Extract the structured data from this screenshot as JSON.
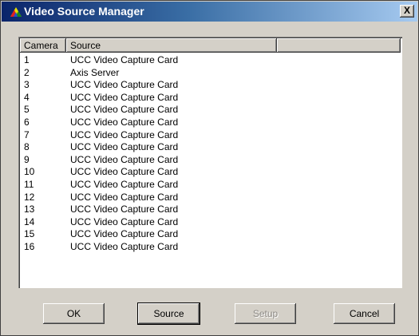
{
  "window": {
    "title": "Video Source Manager",
    "close_label": "X"
  },
  "list": {
    "columns": [
      "Camera",
      "Source",
      ""
    ],
    "rows": [
      {
        "camera": "1",
        "source": "UCC Video Capture Card"
      },
      {
        "camera": "2",
        "source": "Axis Server"
      },
      {
        "camera": "3",
        "source": "UCC Video Capture Card"
      },
      {
        "camera": "4",
        "source": "UCC Video Capture Card"
      },
      {
        "camera": "5",
        "source": "UCC Video Capture Card"
      },
      {
        "camera": "6",
        "source": "UCC Video Capture Card"
      },
      {
        "camera": "7",
        "source": "UCC Video Capture Card"
      },
      {
        "camera": "8",
        "source": "UCC Video Capture Card"
      },
      {
        "camera": "9",
        "source": "UCC Video Capture Card"
      },
      {
        "camera": "10",
        "source": "UCC Video Capture Card"
      },
      {
        "camera": "11",
        "source": "UCC Video Capture Card"
      },
      {
        "camera": "12",
        "source": "UCC Video Capture Card"
      },
      {
        "camera": "13",
        "source": "UCC Video Capture Card"
      },
      {
        "camera": "14",
        "source": "UCC Video Capture Card"
      },
      {
        "camera": "15",
        "source": "UCC Video Capture Card"
      },
      {
        "camera": "16",
        "source": "UCC Video Capture Card"
      }
    ]
  },
  "buttons": {
    "ok": "OK",
    "source": "Source",
    "setup": "Setup",
    "cancel": "Cancel"
  },
  "colors": {
    "titlebar_start": "#0a246a",
    "titlebar_end": "#a6caf0",
    "dialog_bg": "#d4d0c8"
  }
}
